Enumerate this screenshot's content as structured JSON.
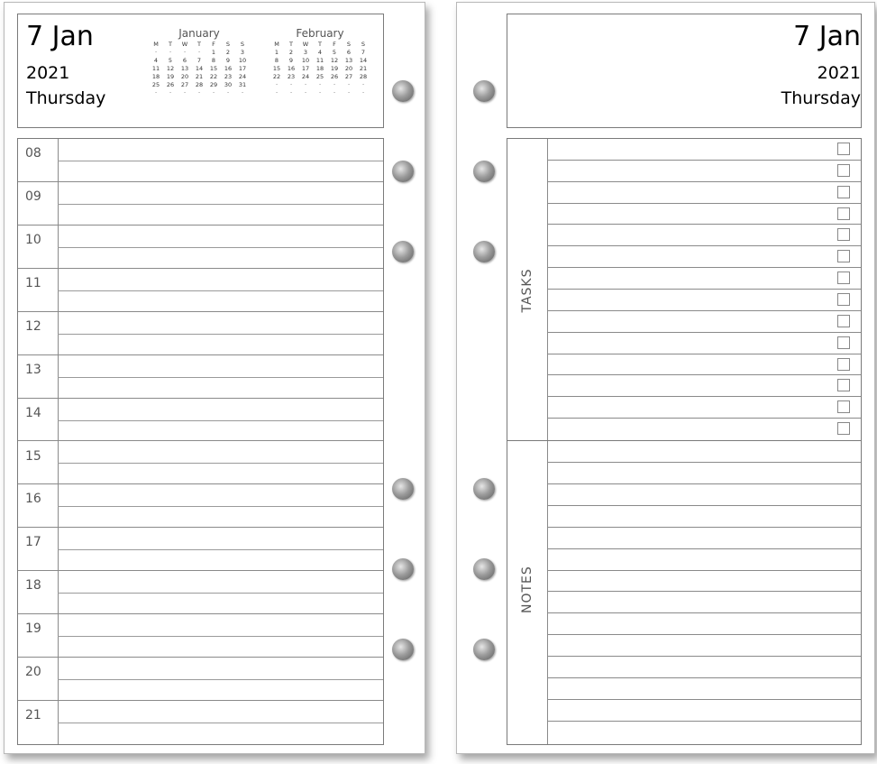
{
  "left_page": {
    "day_month": "7 Jan",
    "year": "2021",
    "weekday": "Thursday",
    "mini_calendars": [
      {
        "month": "January",
        "weekday_headers": [
          "M",
          "T",
          "W",
          "T",
          "F",
          "S",
          "S"
        ],
        "weeks": [
          [
            "·",
            "·",
            "·",
            "·",
            "1",
            "2",
            "3"
          ],
          [
            "4",
            "5",
            "6",
            "7",
            "8",
            "9",
            "10"
          ],
          [
            "11",
            "12",
            "13",
            "14",
            "15",
            "16",
            "17"
          ],
          [
            "18",
            "19",
            "20",
            "21",
            "22",
            "23",
            "24"
          ],
          [
            "25",
            "26",
            "27",
            "28",
            "29",
            "30",
            "31"
          ],
          [
            "·",
            "·",
            "·",
            "·",
            "·",
            "·",
            "·"
          ]
        ]
      },
      {
        "month": "February",
        "weekday_headers": [
          "M",
          "T",
          "W",
          "T",
          "F",
          "S",
          "S"
        ],
        "weeks": [
          [
            "1",
            "2",
            "3",
            "4",
            "5",
            "6",
            "7"
          ],
          [
            "8",
            "9",
            "10",
            "11",
            "12",
            "13",
            "14"
          ],
          [
            "15",
            "16",
            "17",
            "18",
            "19",
            "20",
            "21"
          ],
          [
            "22",
            "23",
            "24",
            "25",
            "26",
            "27",
            "28"
          ],
          [
            "·",
            "·",
            "·",
            "·",
            "·",
            "·",
            "·"
          ],
          [
            "·",
            "·",
            "·",
            "·",
            "·",
            "·",
            "·"
          ]
        ]
      }
    ],
    "hours": [
      "08",
      "09",
      "10",
      "11",
      "12",
      "13",
      "14",
      "15",
      "16",
      "17",
      "18",
      "19",
      "20",
      "21"
    ]
  },
  "right_page": {
    "day_month": "7 Jan",
    "year": "2021",
    "weekday": "Thursday",
    "tasks_label": "TASKS",
    "notes_label": "NOTES",
    "task_count": 14,
    "note_count": 14
  }
}
